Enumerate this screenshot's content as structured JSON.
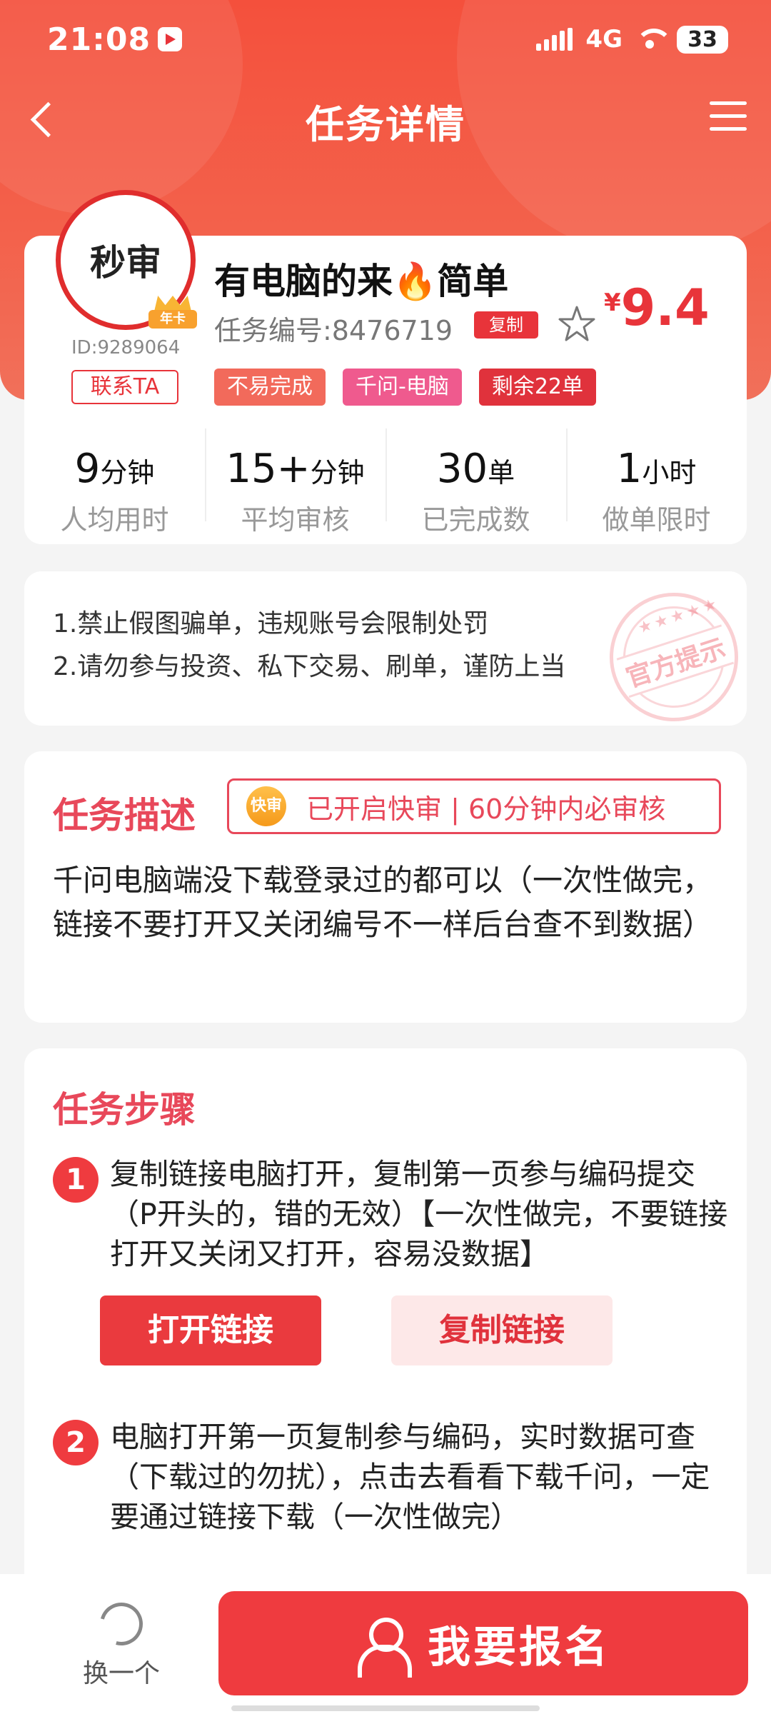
{
  "status_bar": {
    "time": "21:08",
    "network": "4G",
    "battery": "33"
  },
  "nav": {
    "title": "任务详情"
  },
  "task": {
    "avatar_text": "秒审",
    "crown_label": "年卡",
    "user_id": "ID:9289064",
    "contact_label": "联系TA",
    "title": "有电脑的来",
    "title_suffix": "简单",
    "fire_icon": "🔥",
    "task_no": "任务编号:8476719",
    "copy_tag": "复制",
    "price_currency": "¥",
    "price_value": "9.4",
    "tags": [
      "不易完成",
      "千问-电脑",
      "剩余22单"
    ]
  },
  "stats": [
    {
      "value": "9",
      "unit": "分钟",
      "label": "人均用时"
    },
    {
      "value": "15+",
      "unit": "分钟",
      "label": "平均审核"
    },
    {
      "value": "30",
      "unit": "单",
      "label": "已完成数"
    },
    {
      "value": "1",
      "unit": "小时",
      "label": "做单限时"
    }
  ],
  "notice": {
    "lines": [
      "1.禁止假图骗单，违规账号会限制处罚",
      "2.请勿参与投资、私下交易、刷单，谨防上当"
    ],
    "stamp_text": "官方提示",
    "stamp_stars": "★★★★★"
  },
  "description": {
    "title": "任务描述",
    "fast_badge": "快审",
    "fast_text": "已开启快审 | 60分钟内必审核",
    "text": "千问电脑端没下载登录过的都可以（一次性做完，链接不要打开又关闭编号不一样后台查不到数据）"
  },
  "steps": {
    "title": "任务步骤",
    "items": [
      {
        "num": "1",
        "text": "复制链接电脑打开，复制第一页参与编码提交（P开头的，错的无效）【一次性做完，不要链接打开又关闭又打开，容易没数据】"
      },
      {
        "num": "2",
        "text": "电脑打开第一页复制参与编码，实时数据可查（下载过的勿扰），点击去看看下载千问，一定要通过链接下载（一次性做完）"
      }
    ],
    "open_link": "打开链接",
    "copy_link": "复制链接"
  },
  "bottom": {
    "swap_label": "换一个",
    "signup_label": "我要报名"
  },
  "colors": {
    "primary": "#ef3b3f",
    "accent": "#e8485a",
    "header": "#f4503c"
  },
  "icons": [
    "back-icon",
    "menu-icon",
    "star-icon",
    "refresh-icon",
    "person-icon",
    "fire-icon"
  ]
}
